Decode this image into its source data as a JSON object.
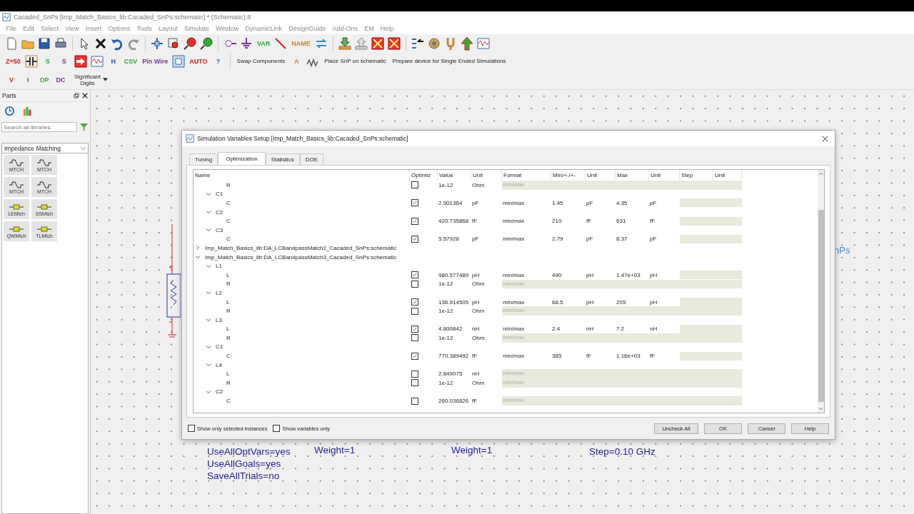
{
  "window": {
    "title": "Cacaded_SnPs [Imp_Match_Basics_lib:Cacaded_SnPs:schematic] * (Schematic):8"
  },
  "menu": [
    "File",
    "Edit",
    "Select",
    "View",
    "Insert",
    "Options",
    "Tools",
    "Layout",
    "Simulate",
    "Window",
    "DynamicLink",
    "DesignGuide",
    "Add-Ons",
    "EM",
    "Help"
  ],
  "toolbars": [
    {
      "items": [
        {
          "kind": "icon"
        },
        {
          "kind": "icon"
        },
        {
          "kind": "icon"
        },
        {
          "kind": "icon"
        },
        {
          "kind": "separator"
        },
        {
          "kind": "icon"
        },
        {
          "kind": "icon"
        },
        {
          "kind": "icon"
        },
        {
          "kind": "icon"
        },
        {
          "kind": "separator"
        },
        {
          "kind": "icon"
        },
        {
          "kind": "icon"
        },
        {
          "kind": "icon"
        },
        {
          "kind": "icon"
        },
        {
          "kind": "separator"
        },
        {
          "kind": "icon"
        },
        {
          "kind": "icon"
        },
        {
          "kind": "labeled",
          "label": "VAR"
        },
        {
          "kind": "icon"
        },
        {
          "kind": "labeled",
          "label": "NAME"
        },
        {
          "kind": "icon"
        },
        {
          "kind": "separator"
        },
        {
          "kind": "icon"
        },
        {
          "kind": "icon"
        },
        {
          "kind": "icon"
        },
        {
          "kind": "icon"
        },
        {
          "kind": "separator"
        },
        {
          "kind": "icon"
        },
        {
          "kind": "icon"
        },
        {
          "kind": "icon"
        },
        {
          "kind": "icon"
        },
        {
          "kind": "icon"
        }
      ]
    },
    {
      "items": [
        {
          "kind": "labeled",
          "label": "Z=50"
        },
        {
          "kind": "icon"
        },
        {
          "kind": "labeled",
          "label": "S"
        },
        {
          "kind": "labeled",
          "label": "S"
        },
        {
          "kind": "icon"
        },
        {
          "kind": "icon"
        },
        {
          "kind": "labeled",
          "label": "H"
        },
        {
          "kind": "labeled",
          "label": "CSV"
        },
        {
          "kind": "labeled",
          "label": "Pin Wire"
        },
        {
          "kind": "icon"
        },
        {
          "kind": "labeled",
          "label": "AUTO"
        },
        {
          "kind": "labeled",
          "label": "?"
        },
        {
          "kind": "separator"
        },
        {
          "kind": "text",
          "label": "Swap Components"
        },
        {
          "kind": "labeled",
          "label": "A"
        },
        {
          "kind": "icon"
        },
        {
          "kind": "text",
          "label": "Place SnP on schematic"
        },
        {
          "kind": "text",
          "label": "Prepare device for Single Ended Simulations"
        }
      ]
    },
    {
      "items": [
        {
          "kind": "labeled",
          "label": "V"
        },
        {
          "kind": "labeled",
          "label": "I"
        },
        {
          "kind": "labeled",
          "label": "OP"
        },
        {
          "kind": "labeled",
          "label": "DC"
        },
        {
          "kind": "dropdown",
          "label": "Significant Digits"
        }
      ]
    }
  ],
  "parts_panel": {
    "title": "Parts",
    "search": {
      "placeholder": "Search all libraries"
    },
    "library": "Impedance Matching",
    "items": [
      "MTCH",
      "MTCH",
      "MTCH",
      "MTCH",
      "LEMtch",
      "SSMtch",
      "QWMtch",
      "TLMtch"
    ]
  },
  "canvas": {
    "texts": [
      {
        "text": "nPs",
        "kind": "label"
      },
      {
        "text": "UseAllOptVars=yes",
        "kind": "param"
      },
      {
        "text": "UseAllGoals=yes",
        "kind": "param"
      },
      {
        "text": "SaveAllTrials=no",
        "kind": "param"
      },
      {
        "text": "Weight=1",
        "kind": "param"
      },
      {
        "text": "Weight=1",
        "kind": "param"
      },
      {
        "text": "Step=0.10 GHz",
        "kind": "param"
      }
    ]
  },
  "dialog": {
    "title": "Simulation Variables Setup [Imp_Match_Basics_lib:Cacaded_SnPs:schematic]",
    "tabs": [
      {
        "label": "Tuning",
        "selected": false
      },
      {
        "label": "Optimization",
        "selected": true
      },
      {
        "label": "Statistics",
        "selected": false
      },
      {
        "label": "DOE",
        "selected": false
      }
    ],
    "columns": [
      "Name",
      "Optimiz",
      "Value",
      "Unit",
      "Format",
      "Min/+-/+-",
      "Unit",
      "Max",
      "Unit",
      "Step",
      "Unit"
    ],
    "tree": [
      {
        "children": [
          {
            "children": [
              {
                "name": "R",
                "optimize": false,
                "value": "1e-12",
                "unit": "Ohm",
                "format": "min/max"
              }
            ]
          },
          {
            "name": "C1",
            "expanded": true,
            "children": [
              {
                "name": "C",
                "optimize": true,
                "value": "2.901364",
                "unit": "pF",
                "format": "min/max",
                "min": "1.45",
                "min_unit": "pF",
                "max": "4.35",
                "max_unit": "pF"
              }
            ]
          },
          {
            "name": "C2",
            "expanded": true,
            "children": [
              {
                "name": "C",
                "optimize": true,
                "value": "420.735868",
                "unit": "fF",
                "format": "min/max",
                "min": "210",
                "min_unit": "fF",
                "max": "631",
                "max_unit": "fF"
              }
            ]
          },
          {
            "name": "C3",
            "expanded": true,
            "children": [
              {
                "name": "C",
                "optimize": true,
                "value": "5.57928",
                "unit": "pF",
                "format": "min/max",
                "min": "2.79",
                "min_unit": "pF",
                "max": "8.37",
                "max_unit": "pF"
              }
            ]
          }
        ]
      },
      {
        "name": "Imp_Match_Basics_lib:DA_LCBandpassMatch2_Cacaded_SnPs:schematic",
        "expanded": false
      },
      {
        "name": "Imp_Match_Basics_lib:DA_LCBandpassMatch3_Cacaded_SnPs:schematic",
        "expanded": true,
        "children": [
          {
            "name": "L1",
            "expanded": true,
            "children": [
              {
                "name": "L",
                "optimize": true,
                "value": "980.577489",
                "unit": "pH",
                "format": "min/max",
                "min": "490",
                "min_unit": "pH",
                "max": "1.47e+03",
                "max_unit": "pH"
              },
              {
                "name": "R",
                "optimize": false,
                "value": "1e-12",
                "unit": "Ohm",
                "format": "min/max"
              }
            ]
          },
          {
            "name": "L2",
            "expanded": true,
            "children": [
              {
                "name": "L",
                "optimize": true,
                "value": "136.914505",
                "unit": "pH",
                "format": "min/max",
                "min": "68.5",
                "min_unit": "pH",
                "max": "205",
                "max_unit": "pH"
              },
              {
                "name": "R",
                "optimize": false,
                "value": "1e-12",
                "unit": "Ohm",
                "format": "min/max"
              }
            ]
          },
          {
            "name": "L3",
            "expanded": true,
            "children": [
              {
                "name": "L",
                "optimize": true,
                "value": "4.800842",
                "unit": "nH",
                "format": "min/max",
                "min": "2.4",
                "min_unit": "nH",
                "max": "7.2",
                "max_unit": "nH"
              },
              {
                "name": "R",
                "optimize": false,
                "value": "1e-12",
                "unit": "Ohm",
                "format": "min/max"
              }
            ]
          },
          {
            "name": "C1",
            "expanded": true,
            "children": [
              {
                "name": "C",
                "optimize": true,
                "value": "770.389492",
                "unit": "fF",
                "format": "min/max",
                "min": "385",
                "min_unit": "fF",
                "max": "1.16e+03",
                "max_unit": "fF"
              }
            ]
          },
          {
            "name": "L4",
            "expanded": true,
            "children": [
              {
                "name": "L",
                "optimize": false,
                "value": "2.849075",
                "unit": "nH",
                "format": "min/max"
              },
              {
                "name": "R",
                "optimize": false,
                "value": "1e-12",
                "unit": "Ohm",
                "format": "min/max"
              }
            ]
          },
          {
            "name": "C2",
            "expanded": true,
            "children": [
              {
                "name": "C",
                "optimize": false,
                "value": "260.036826",
                "unit": "fF",
                "format": "min/max"
              }
            ]
          }
        ]
      }
    ],
    "options": [
      {
        "label": "Show only selected instances",
        "checked": false
      },
      {
        "label": "Show variables only",
        "checked": false
      }
    ],
    "buttons": [
      "Uncheck All",
      "OK",
      "Cancel",
      "Help"
    ]
  }
}
